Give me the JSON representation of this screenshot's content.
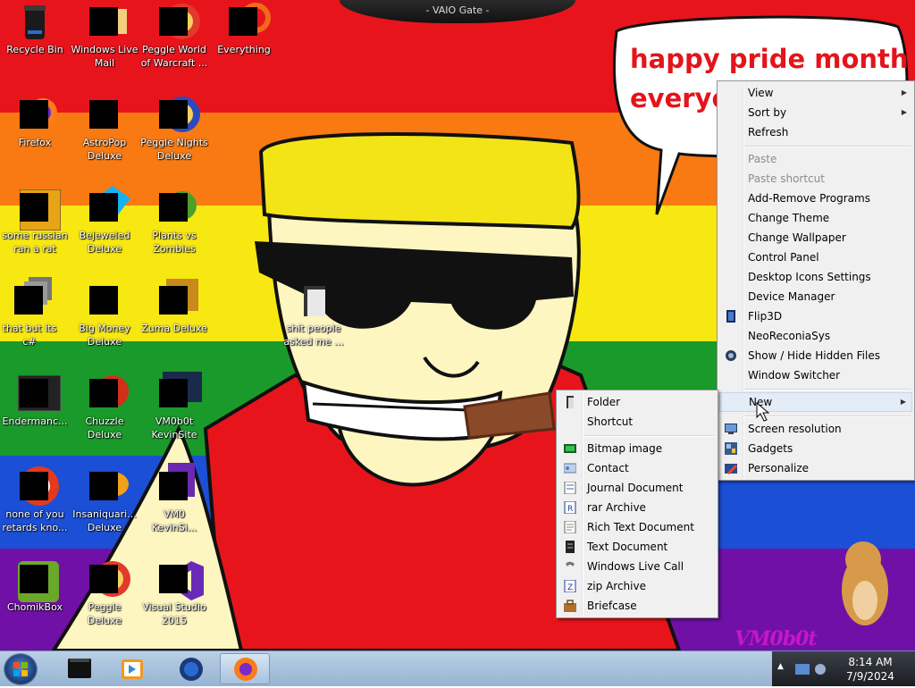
{
  "window_title": "- VAIO Gate -",
  "wallpaper": {
    "speech_bubble": "happy pride month\neveryone"
  },
  "signature": "VM0b0t",
  "desktop_icons": [
    {
      "label": "Recycle Bin",
      "icon": "recycle-bin-icon"
    },
    {
      "label": "Windows Live\nMail",
      "icon": "mail-icon"
    },
    {
      "label": "Peggle World\nof Warcraft ...",
      "icon": "peggle-icon"
    },
    {
      "label": "Everything",
      "icon": "search-icon"
    },
    {
      "label": "Firefox",
      "icon": "firefox-icon"
    },
    {
      "label": "AstroPop\nDeluxe",
      "icon": "game-icon"
    },
    {
      "label": "Peggle Nights\nDeluxe",
      "icon": "peggle-icon"
    },
    {
      "label": "some russian\nran a rat",
      "icon": "app-icon"
    },
    {
      "label": "Bejeweled\nDeluxe",
      "icon": "gem-icon"
    },
    {
      "label": "Plants vs\nZombies",
      "icon": "plant-icon"
    },
    {
      "label": "that but its c#",
      "icon": "app-icon"
    },
    {
      "label": "Big Money\nDeluxe",
      "icon": "money-icon"
    },
    {
      "label": "Zuma Deluxe",
      "icon": "zuma-icon"
    },
    {
      "label": "Endermanc...",
      "icon": "app-icon"
    },
    {
      "label": "Chuzzle\nDeluxe",
      "icon": "chuzzle-icon"
    },
    {
      "label": "VM0b0t\nKevinSite",
      "icon": "app-icon"
    },
    {
      "label": "none of you\nretards kno...",
      "icon": "app-icon"
    },
    {
      "label": "Insaniquari...\nDeluxe",
      "icon": "fish-icon"
    },
    {
      "label": "VM0\nKevinSi...",
      "icon": "app-icon"
    },
    {
      "label": "ChomikBox",
      "icon": "hamster-icon"
    },
    {
      "label": "Peggle Deluxe",
      "icon": "peggle-icon"
    },
    {
      "label": "Visual Studio\n2015",
      "icon": "visual-studio-icon"
    },
    {
      "label": "shit people\nasked me ...",
      "icon": "folder-icon"
    }
  ],
  "context_menu": {
    "items": [
      {
        "label": "View",
        "submenu": true
      },
      {
        "label": "Sort by",
        "submenu": true
      },
      {
        "label": "Refresh"
      },
      {
        "label": "Paste",
        "disabled": true
      },
      {
        "label": "Paste shortcut",
        "disabled": true
      },
      {
        "label": "Add-Remove Programs"
      },
      {
        "label": "Change Theme"
      },
      {
        "label": "Change Wallpaper"
      },
      {
        "label": "Control Panel"
      },
      {
        "label": "Desktop Icons Settings"
      },
      {
        "label": "Device Manager"
      },
      {
        "label": "Flip3D",
        "icon": "flip3d-icon"
      },
      {
        "label": "NeoReconiaSys"
      },
      {
        "label": "Show / Hide Hidden Files",
        "icon": "eye-icon"
      },
      {
        "label": "Window Switcher"
      },
      {
        "label": "New",
        "submenu": true
      },
      {
        "label": "Screen resolution",
        "icon": "monitor-icon"
      },
      {
        "label": "Gadgets",
        "icon": "gadgets-icon"
      },
      {
        "label": "Personalize",
        "icon": "personalize-icon"
      }
    ]
  },
  "new_submenu": {
    "items": [
      {
        "label": "Folder",
        "icon": "folder-icon"
      },
      {
        "label": "Shortcut",
        "icon": "shortcut-icon"
      },
      {
        "label": "Bitmap image",
        "icon": "bitmap-icon"
      },
      {
        "label": "Contact",
        "icon": "contact-icon"
      },
      {
        "label": "Journal Document",
        "icon": "journal-icon"
      },
      {
        "label": "rar Archive",
        "icon": "rar-icon"
      },
      {
        "label": "Rich Text Document",
        "icon": "rtf-icon"
      },
      {
        "label": "Text Document",
        "icon": "text-icon"
      },
      {
        "label": "Windows Live Call",
        "icon": "phone-icon"
      },
      {
        "label": "zip Archive",
        "icon": "zip-icon"
      },
      {
        "label": "Briefcase",
        "icon": "briefcase-icon"
      }
    ]
  },
  "taskbar": {
    "clock_time": "8:14 AM",
    "clock_date": "7/9/2024",
    "pinned": [
      "terminal-icon",
      "media-player-icon",
      "globe-icon",
      "firefox-icon"
    ]
  },
  "colors": {
    "red": "#e8141c",
    "orange": "#f97a12",
    "yellow": "#f8e812",
    "green": "#1a9a2a",
    "blue": "#1a4fd6",
    "purple": "#7010a6"
  }
}
